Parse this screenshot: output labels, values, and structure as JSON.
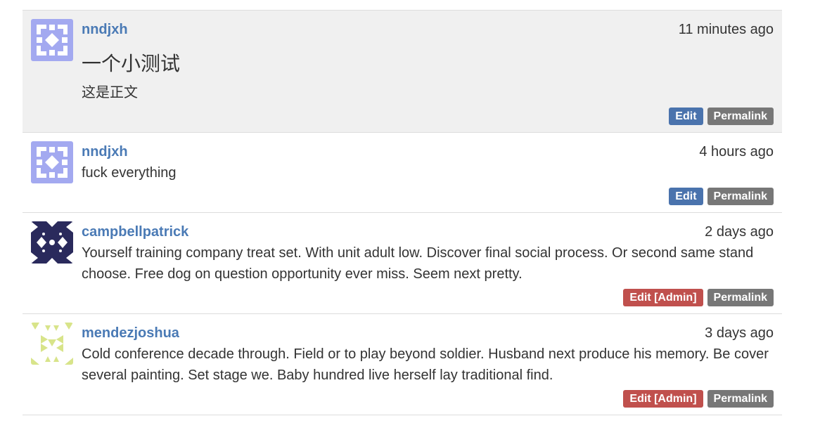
{
  "posts": [
    {
      "author": "nndjxh",
      "time": "11 minutes ago",
      "title": "一个小测试",
      "body": "这是正文",
      "edit_label": "Edit",
      "permalink_label": "Permalink",
      "avatar_color": "#a3a9f0"
    },
    {
      "author": "nndjxh",
      "time": "4 hours ago",
      "body": "fuck everything",
      "edit_label": "Edit",
      "permalink_label": "Permalink",
      "avatar_color": "#a3a9f0"
    },
    {
      "author": "campbellpatrick",
      "time": "2 days ago",
      "body": "Yourself training company treat set. With unit adult low. Discover final social process. Or second same stand choose. Free dog on question opportunity ever miss. Seem next pretty.",
      "edit_label": "Edit [Admin]",
      "permalink_label": "Permalink",
      "avatar_color": "#2a2a5c"
    },
    {
      "author": "mendezjoshua",
      "time": "3 days ago",
      "body": "Cold conference decade through. Field or to play beyond soldier. Husband next produce his memory. Be cover several painting. Set stage we. Baby hundred live herself lay traditional find.",
      "edit_label": "Edit [Admin]",
      "permalink_label": "Permalink",
      "avatar_color": "#d8e48a"
    }
  ],
  "colors": {
    "author_link": "#4a7ab5",
    "edit_button": "#4a73ad",
    "admin_edit_button": "#c0504d",
    "permalink_button": "#777777",
    "highlight_background": "#f0f0f0"
  }
}
